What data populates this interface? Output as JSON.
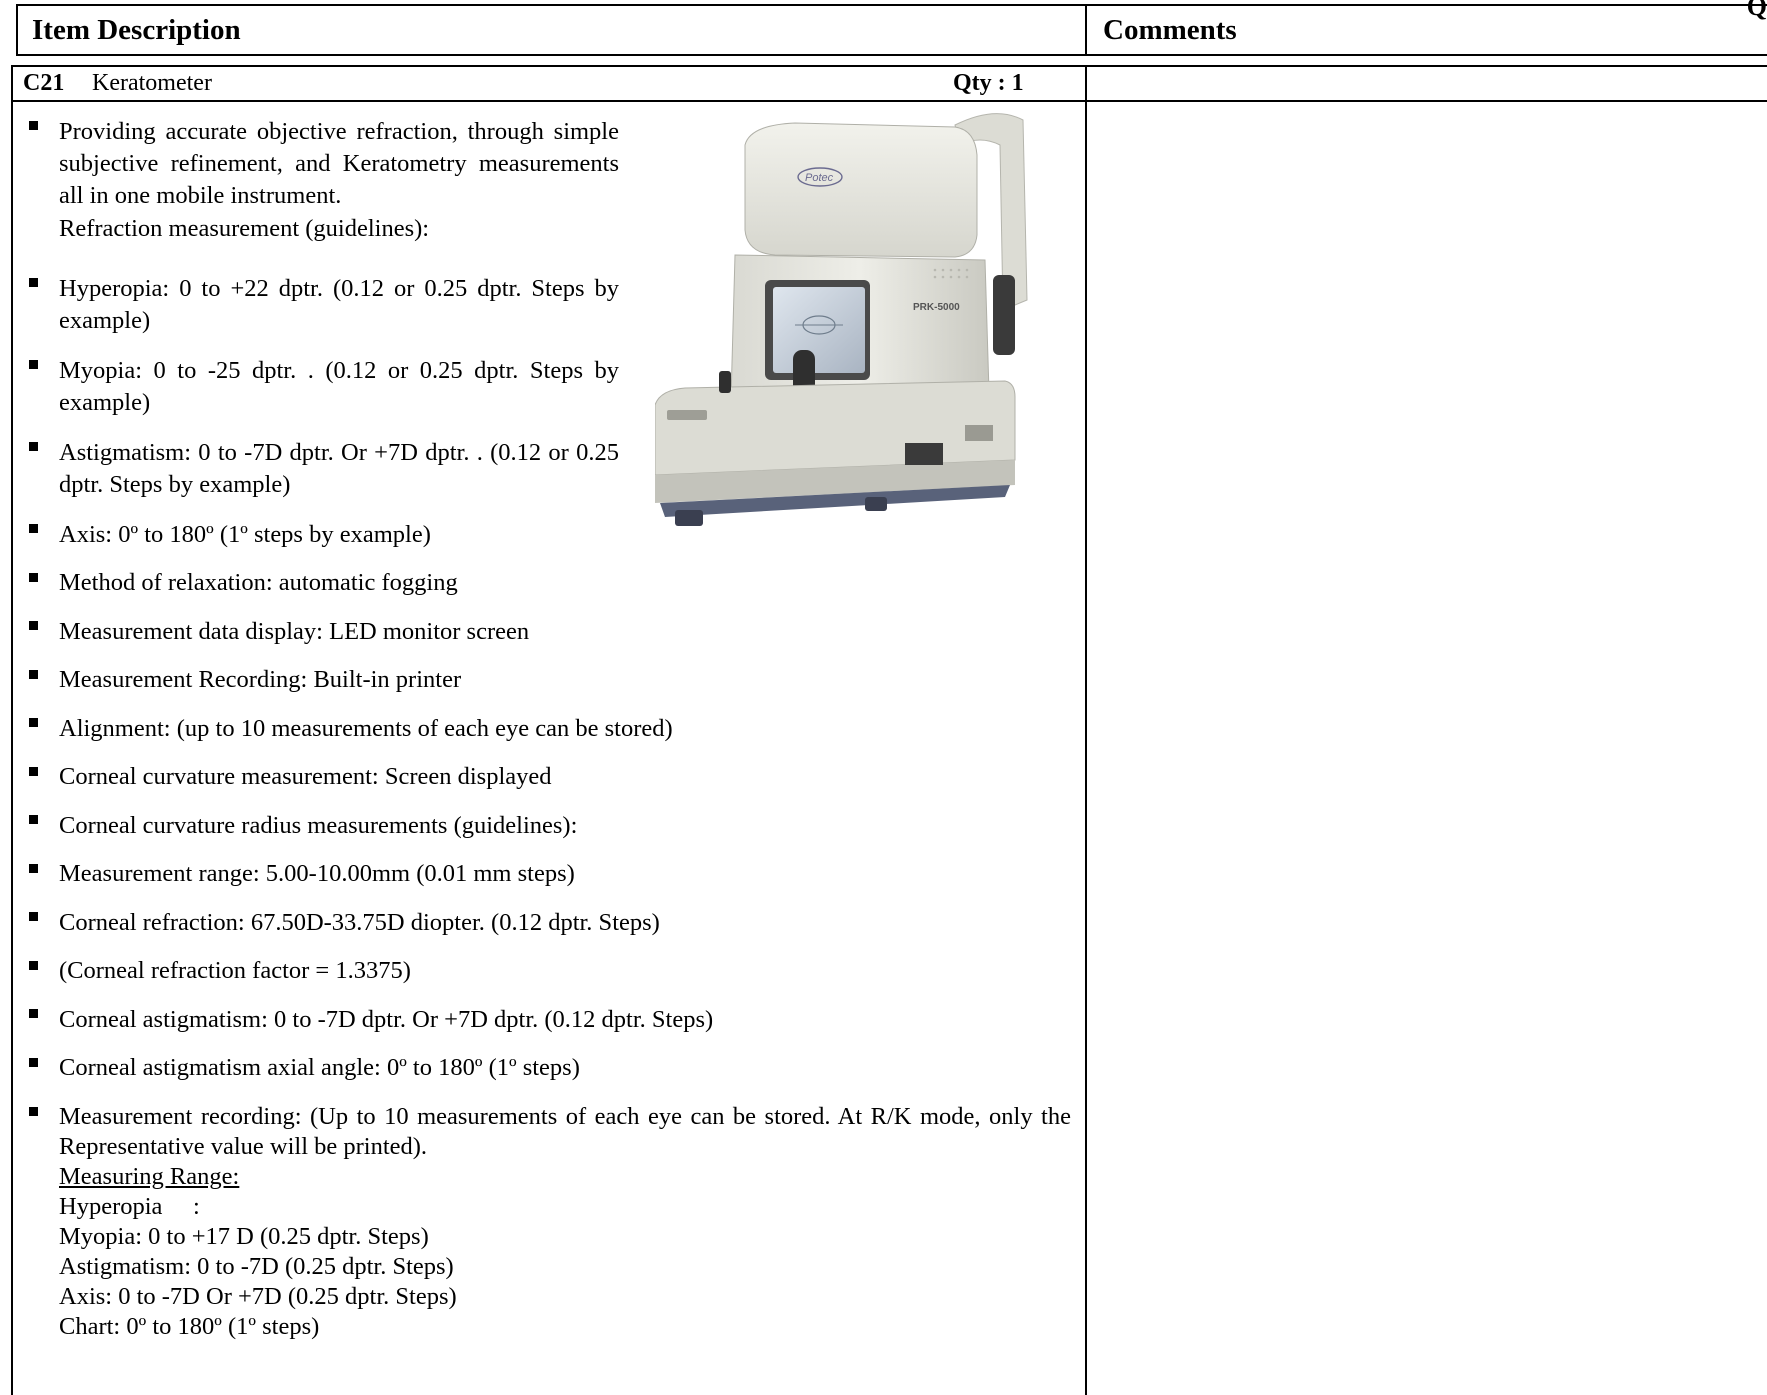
{
  "header": {
    "item_description": "Item Description",
    "comments": "Comments",
    "corner_letter": "Q"
  },
  "item": {
    "code": "C21",
    "name": "Keratometer",
    "qty": "Qty : 1"
  },
  "bullets": [
    "Providing accurate objective refraction, through simple subjective refinement, and Keratometry measurements all in one mobile instrument.",
    "Hyperopia: 0 to +22 dptr. (0.12 or 0.25 dptr. Steps by example)",
    "Myopia: 0 to -25 dptr. . (0.12 or 0.25 dptr. Steps by example)",
    "Astigmatism: 0 to -7D dptr. Or +7D dptr. . (0.12 or 0.25 dptr. Steps by example)",
    "Axis: 0º to 180º (1º steps by example)",
    "Method of relaxation: automatic fogging",
    "Measurement data display: LED monitor screen",
    "Measurement Recording: Built-in printer",
    "Alignment: (up to 10 measurements of each eye can be stored)",
    "Corneal curvature measurement: Screen displayed",
    "Corneal curvature radius measurements (guidelines):",
    "Measurement range: 5.00-10.00mm (0.01 mm steps)",
    "Corneal refraction: 67.50D-33.75D diopter. (0.12 dptr. Steps)",
    "(Corneal refraction factor = 1.3375)",
    "Corneal astigmatism: 0 to -7D dptr. Or +7D dptr. (0.12 dptr. Steps)",
    "Corneal astigmatism axial angle: 0º to 180º (1º steps)",
    "Measurement recording: (Up to 10 measurements of each eye can be stored. At R/K mode, only the  Representative value will be printed)."
  ],
  "refraction_heading": "Refraction measurement (guidelines):",
  "measuring_range": {
    "heading": "Measuring Range:",
    "lines": [
      "Hyperopia     :",
      "Myopia: 0 to +17 D (0.25 dptr. Steps)",
      "Astigmatism: 0 to -7D (0.25 dptr. Steps)",
      "Axis: 0 to -7D Or +7D (0.25 dptr. Steps)",
      "Chart: 0º to 180º (1º steps)"
    ]
  },
  "photo": {
    "brand": "Potec",
    "model": "PRK-5000"
  }
}
